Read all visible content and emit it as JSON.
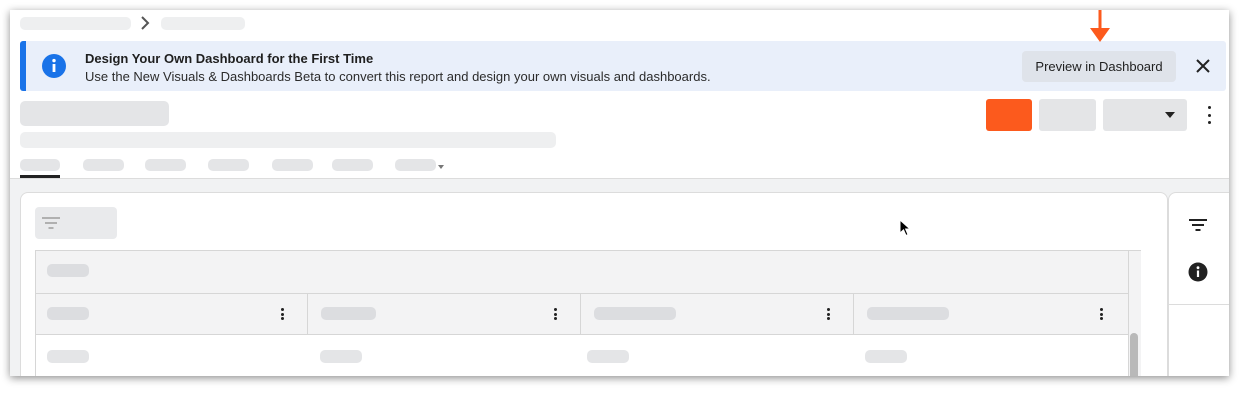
{
  "banner": {
    "title": "Design Your Own Dashboard for the First Time",
    "message": "Use the New Visuals & Dashboards Beta to convert this report and design your own visuals and dashboards.",
    "preview_button": "Preview in Dashboard",
    "icon": "info-icon",
    "close_icon": "close-icon"
  },
  "colors": {
    "accent_blue": "#1a73e8",
    "banner_bg": "#e9effa",
    "primary_orange": "#fc5a1d",
    "annotation_arrow": "#fc5a1d"
  },
  "icons": {
    "breadcrumb_separator": "chevron-right-icon",
    "more_menu": "more-vertical-icon",
    "dropdown": "caret-down-icon",
    "side_filter": "filter-icon",
    "side_info": "info-icon",
    "table_filter": "filter-icon"
  }
}
